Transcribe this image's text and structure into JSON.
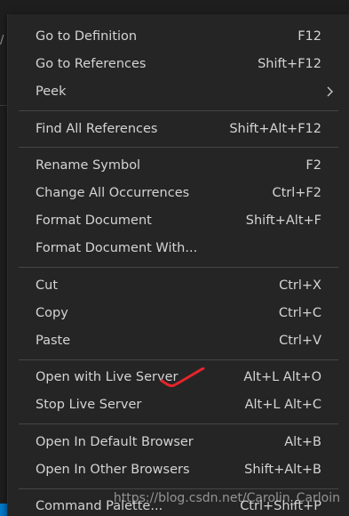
{
  "context_menu": {
    "groups": [
      [
        {
          "label": "Go to Definition",
          "shortcut": "F12"
        },
        {
          "label": "Go to References",
          "shortcut": "Shift+F12"
        },
        {
          "label": "Peek",
          "shortcut": "",
          "submenu": true
        }
      ],
      [
        {
          "label": "Find All References",
          "shortcut": "Shift+Alt+F12"
        }
      ],
      [
        {
          "label": "Rename Symbol",
          "shortcut": "F2"
        },
        {
          "label": "Change All Occurrences",
          "shortcut": "Ctrl+F2"
        },
        {
          "label": "Format Document",
          "shortcut": "Shift+Alt+F"
        },
        {
          "label": "Format Document With...",
          "shortcut": ""
        }
      ],
      [
        {
          "label": "Cut",
          "shortcut": "Ctrl+X"
        },
        {
          "label": "Copy",
          "shortcut": "Ctrl+C"
        },
        {
          "label": "Paste",
          "shortcut": "Ctrl+V"
        }
      ],
      [
        {
          "label": "Open with Live Server",
          "shortcut": "Alt+L Alt+O"
        },
        {
          "label": "Stop Live Server",
          "shortcut": "Alt+L Alt+C"
        }
      ],
      [
        {
          "label": "Open In Default Browser",
          "shortcut": "Alt+B"
        },
        {
          "label": "Open In Other Browsers",
          "shortcut": "Shift+Alt+B"
        }
      ],
      [
        {
          "label": "Command Palette...",
          "shortcut": "Ctrl+Shift+P"
        }
      ]
    ]
  },
  "editor_fragment": {
    "slash": "/"
  },
  "annotation": {
    "icon": "red-checkmark-icon",
    "color": "#e5252a"
  },
  "watermark": {
    "text": "https://blog.csdn.net/Carolin_Carloin"
  },
  "colors": {
    "menu_bg": "#252526",
    "text": "#d4d4d4",
    "separator": "#454545",
    "statusbar_blue": "#007acc"
  }
}
